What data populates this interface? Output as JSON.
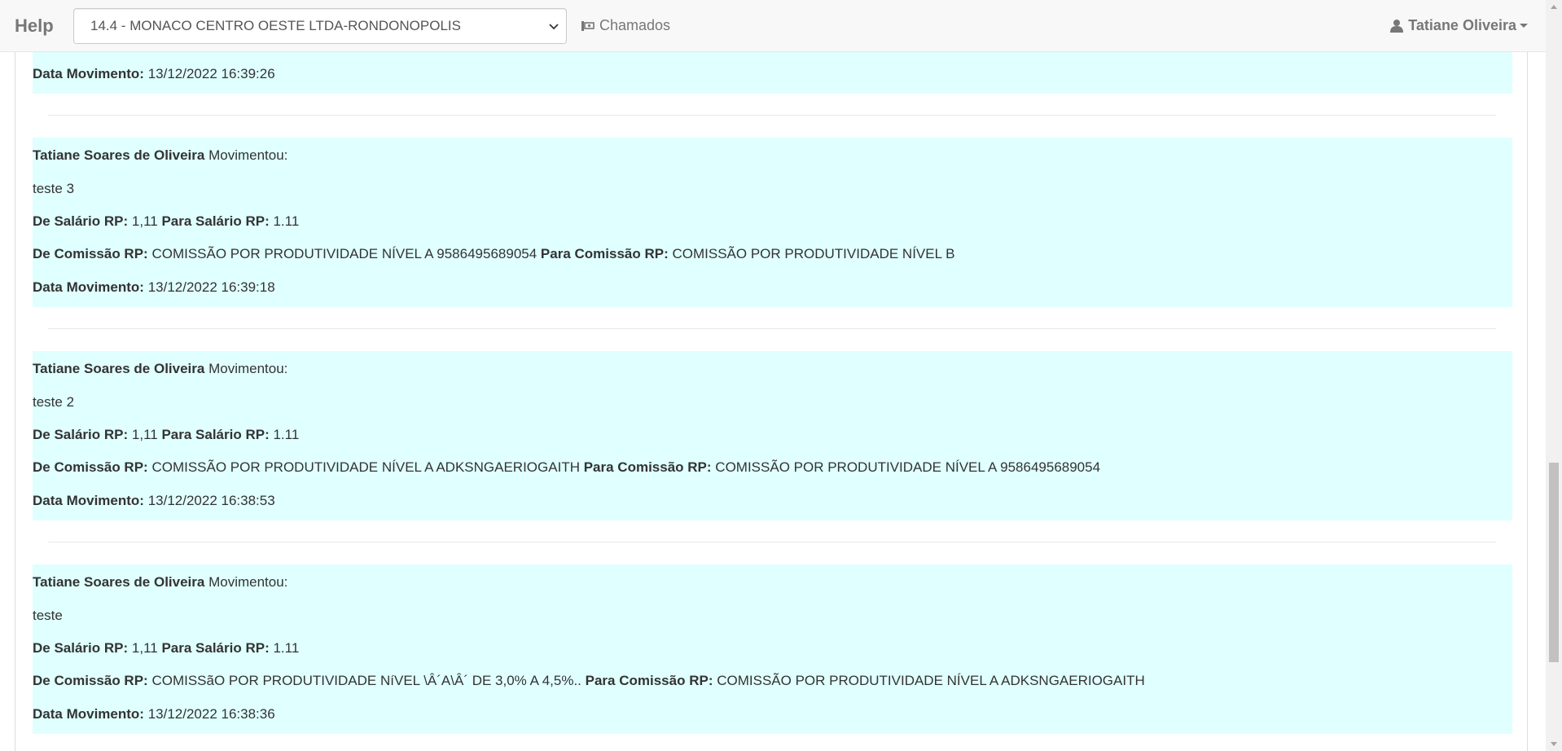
{
  "navbar": {
    "brand": "Help",
    "company_select": "14.4 - MONACO CENTRO OESTE LTDA-RONDONOPOLIS",
    "chamados": "Chamados",
    "user": "Tatiane Oliveira"
  },
  "labels": {
    "data_movimento": "Data Movimento:",
    "movimentou": "Movimentou:",
    "de_salario": "De Salário RP:",
    "para_salario": "Para Salário RP:",
    "de_comissao": "De Comissão RP:",
    "para_comissao": "Para Comissão RP:"
  },
  "partial_entry": {
    "data": "13/12/2022 16:39:26"
  },
  "entries": [
    {
      "user": "Tatiane Soares de Oliveira",
      "note": "teste 3",
      "de_salario": "1,11",
      "para_salario": "1.11",
      "de_comissao": "COMISSÃO POR PRODUTIVIDADE NÍVEL A 9586495689054",
      "para_comissao": "COMISSÃO POR PRODUTIVIDADE NÍVEL B",
      "data": "13/12/2022 16:39:18"
    },
    {
      "user": "Tatiane Soares de Oliveira",
      "note": "teste 2",
      "de_salario": "1,11",
      "para_salario": "1.11",
      "de_comissao": "COMISSÃO POR PRODUTIVIDADE NÍVEL A ADKSNGAERIOGAITH",
      "para_comissao": "COMISSÃO POR PRODUTIVIDADE NÍVEL A 9586495689054",
      "data": "13/12/2022 16:38:53"
    },
    {
      "user": "Tatiane Soares de Oliveira",
      "note": "teste",
      "de_salario": "1,11",
      "para_salario": "1.11",
      "de_comissao": "COMISSãO POR PRODUTIVIDADE NíVEL \\Â´A\\Â´ DE 3,0% A 4,5%..",
      "para_comissao": "COMISSÃO POR PRODUTIVIDADE NÍVEL A ADKSNGAERIOGAITH",
      "data": "13/12/2022 16:38:36"
    }
  ],
  "colors": {
    "entry_bg": "#e0ffff",
    "navbar_bg": "#f8f8f8"
  }
}
